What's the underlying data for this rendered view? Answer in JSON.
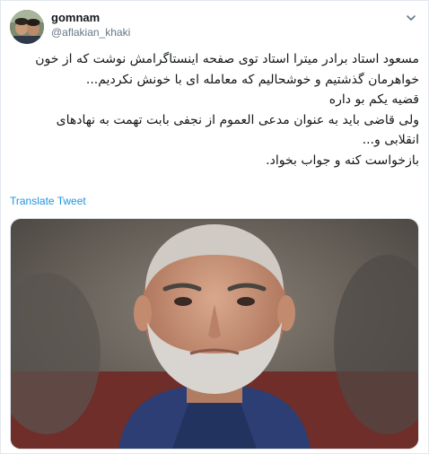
{
  "user": {
    "display_name": "gomnam",
    "handle": "@aflakian_khaki",
    "avatar_icon": "profile-photo"
  },
  "tweet": {
    "lines": [
      "مسعود استاد برادر میترا استاد توی صفحه اینستاگرامش نوشت که از خون",
      "خواهرمان گذشتیم و خوشحالیم که معامله ای با خونش نکردیم...",
      "قضیه یکم بو داره",
      "ولی قاضی باید به عنوان مدعی العموم از نجفی بابت تهمت به نهادهای",
      "انقلابی و...",
      "بازخواست کنه و جواب بخواد."
    ],
    "translate_label": "Translate Tweet",
    "menu_icon": "chevron-down-icon"
  },
  "colors": {
    "link": "#1b95e0",
    "text": "#14171a",
    "secondary": "#657786",
    "border": "#e1e8ed"
  }
}
